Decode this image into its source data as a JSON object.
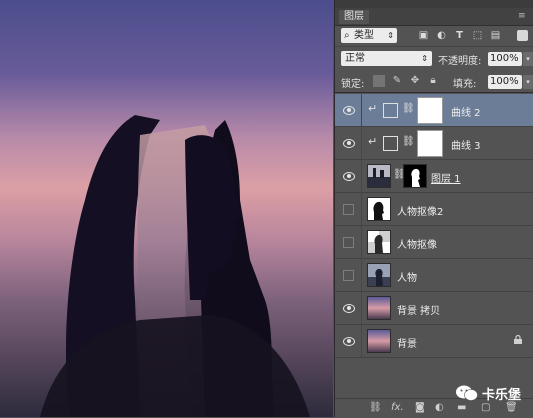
{
  "panel": {
    "tab_label": "图层",
    "menu_icon": "panel-menu-icon",
    "filter": {
      "search_icon": "search-icon",
      "kind_label": "类型"
    },
    "blend_mode": "正常",
    "opacity_label": "不透明度:",
    "opacity_value": "100%",
    "lock_label": "锁定:",
    "fill_label": "填充:",
    "fill_value": "100%"
  },
  "layers": [
    {
      "name": "曲线 2",
      "visible": true,
      "selected": true,
      "type": "curves",
      "clipped": true
    },
    {
      "name": "曲线 3",
      "visible": true,
      "selected": false,
      "type": "curves",
      "clipped": true
    },
    {
      "name": "图层 1",
      "visible": true,
      "selected": false,
      "type": "masked-image"
    },
    {
      "name": "人物抠像2",
      "visible": false,
      "selected": false,
      "type": "cutout"
    },
    {
      "name": "人物抠像",
      "visible": false,
      "selected": false,
      "type": "cutout"
    },
    {
      "name": "人物",
      "visible": false,
      "selected": false,
      "type": "photo"
    },
    {
      "name": "背景 拷贝",
      "visible": true,
      "selected": false,
      "type": "sky"
    },
    {
      "name": "背景",
      "visible": true,
      "selected": false,
      "type": "sky",
      "locked": true
    }
  ],
  "footer_icons": [
    "link-layers-icon",
    "fx-icon",
    "add-mask-icon",
    "adjustment-layer-icon",
    "new-group-icon",
    "new-layer-icon",
    "trash-icon"
  ],
  "footer_fx": "fx.",
  "watermark": {
    "text": "卡乐堡"
  },
  "colors": {
    "panel_bg": "#535353",
    "selected_row": "#6c7d97"
  }
}
